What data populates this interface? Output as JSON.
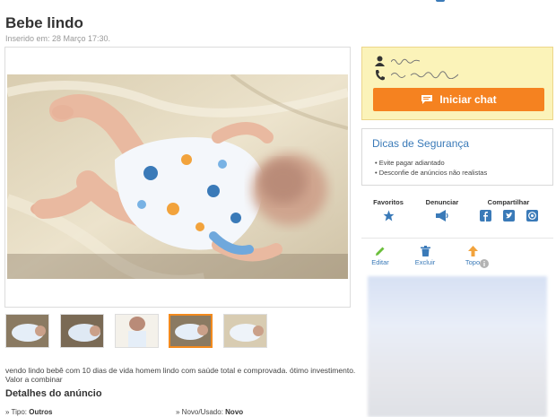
{
  "listing": {
    "title": "Bebe lindo",
    "inserted": "Inserido em: 28 Março 17:30.",
    "description": "vendo lindo bebê com 10 dias de vida homem lindo com saúde total e comprovada. ótimo investimento.",
    "price": "Valor a combinar"
  },
  "details": {
    "title": "Detalhes do anúncio",
    "tipo_label": "Tipo:",
    "tipo_value": "Outros",
    "estado_label": "Novo/Usado:",
    "estado_value": "Novo"
  },
  "contact": {
    "chat_label": "Iniciar chat"
  },
  "tips": {
    "title": "Dicas de Segurança",
    "items": [
      "Evite pagar adiantado",
      "Desconfie de anúncios não realistas"
    ]
  },
  "actions": {
    "favoritos": "Favoritos",
    "denunciar": "Denunciar",
    "compartilhar": "Compartilhar",
    "editar": "Editar",
    "excluir": "Excluir",
    "topo": "Topo"
  },
  "colors": {
    "accent_orange": "#f58220",
    "link_blue": "#3a7ab8",
    "contact_bg": "#fbf3b9"
  }
}
